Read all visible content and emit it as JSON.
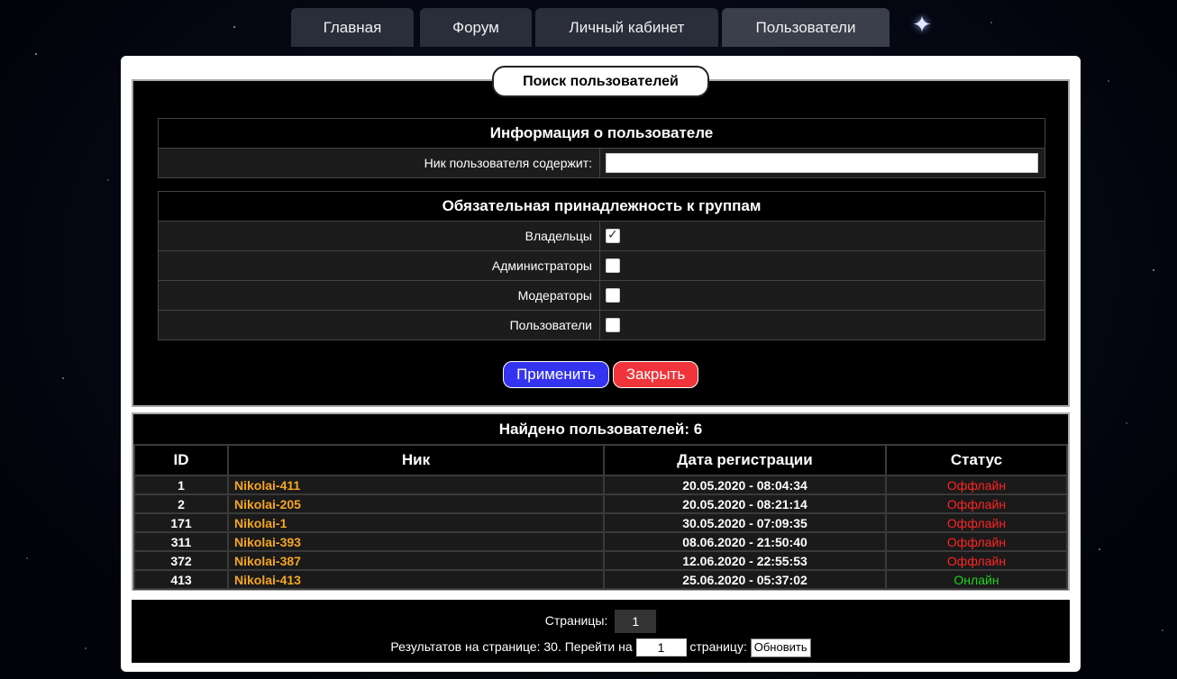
{
  "nav": {
    "tabs": [
      {
        "label": "Главная"
      },
      {
        "label": "Форум"
      },
      {
        "label": "Личный кабинет"
      },
      {
        "label": "Пользователи",
        "active": true
      }
    ]
  },
  "search": {
    "legend": "Поиск пользователей",
    "info_section": {
      "title": "Информация о пользователе",
      "nick_label": "Ник пользователя содержит:",
      "nick_value": ""
    },
    "groups_section": {
      "title": "Обязательная принадлежность к группам",
      "groups": [
        {
          "label": "Владельцы",
          "checked": true
        },
        {
          "label": "Администраторы",
          "checked": false
        },
        {
          "label": "Модераторы",
          "checked": false
        },
        {
          "label": "Пользователи",
          "checked": false
        }
      ]
    },
    "apply_label": "Применить",
    "close_label": "Закрыть"
  },
  "results": {
    "title": "Найдено пользователей: 6",
    "columns": [
      "ID",
      "Ник",
      "Дата регистрации",
      "Статус"
    ],
    "rows": [
      {
        "id": "1",
        "nick": "Nikolai-411",
        "date": "20.05.2020 - 08:04:34",
        "status": "Оффлайн",
        "online": false
      },
      {
        "id": "2",
        "nick": "Nikolai-205",
        "date": "20.05.2020 - 08:21:14",
        "status": "Оффлайн",
        "online": false
      },
      {
        "id": "171",
        "nick": "Nikolai-1",
        "date": "30.05.2020 - 07:09:35",
        "status": "Оффлайн",
        "online": false
      },
      {
        "id": "311",
        "nick": "Nikolai-393",
        "date": "08.06.2020 - 21:50:40",
        "status": "Оффлайн",
        "online": false
      },
      {
        "id": "372",
        "nick": "Nikolai-387",
        "date": "12.06.2020 - 22:55:53",
        "status": "Оффлайн",
        "online": false
      },
      {
        "id": "413",
        "nick": "Nikolai-413",
        "date": "25.06.2020 - 05:37:02",
        "status": "Онлайн",
        "online": true
      }
    ]
  },
  "pager": {
    "pages_label": "Страницы:",
    "current_page": "1",
    "per_page_text": "Результатов на странице: 30. Перейти на",
    "goto_value": "1",
    "page_suffix": "страницу:",
    "refresh_label": "Обновить"
  },
  "colors": {
    "apply": "#3434f0",
    "close": "#f0343a",
    "nick": "#f5a623",
    "offline": "#ff2424",
    "online": "#21d321"
  }
}
